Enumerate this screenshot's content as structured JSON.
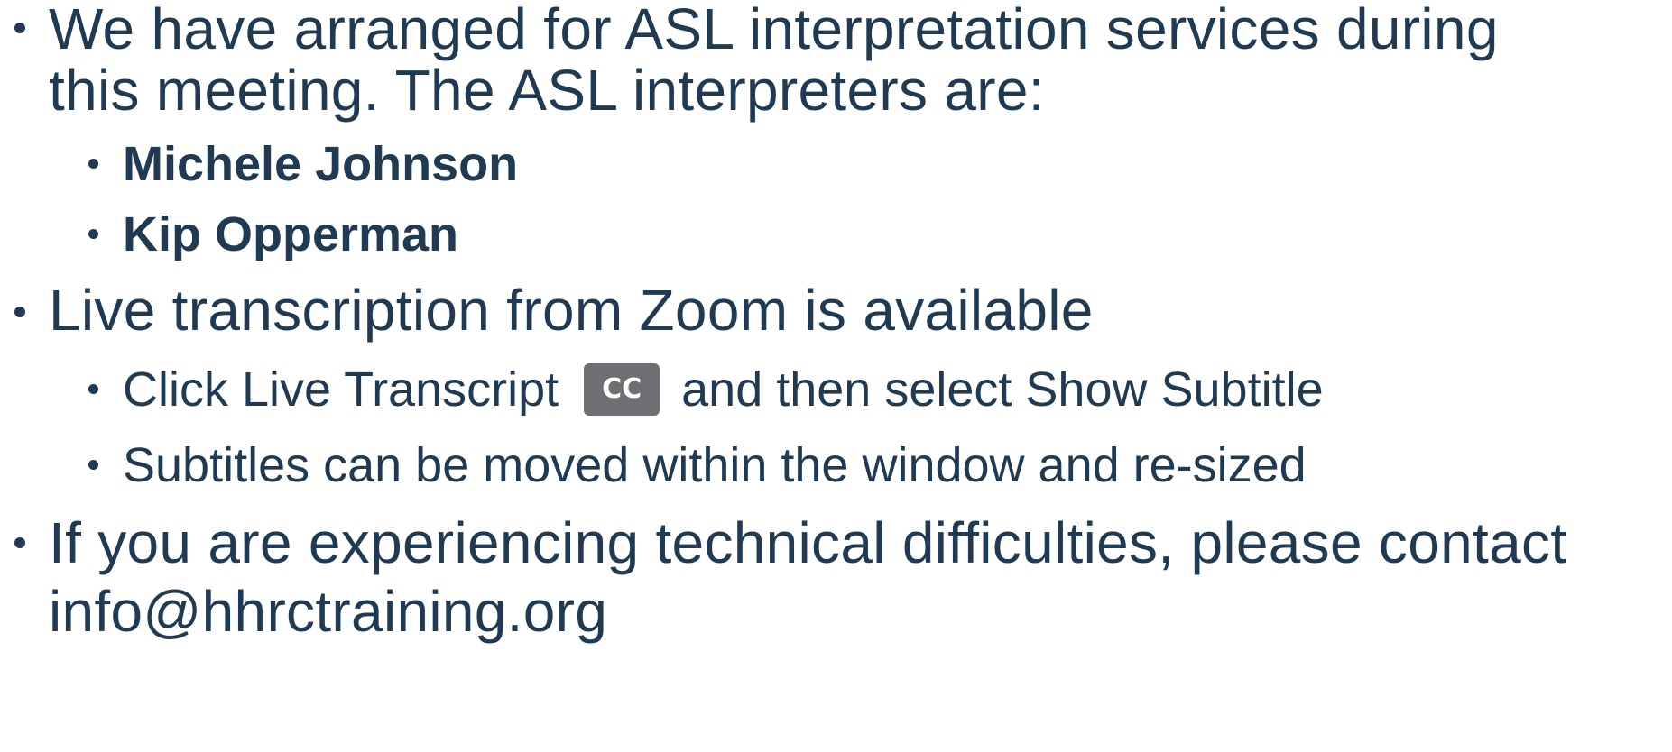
{
  "content": {
    "item1": {
      "line1": "We have arranged for ASL interpretation services during",
      "line2": "this meeting. The ASL interpreters are:"
    },
    "interpreters": [
      "Michele Johnson",
      "Kip Opperman"
    ],
    "item2": "Live transcription from Zoom is available",
    "sub1": {
      "before": "Click Live Transcript",
      "icon_label": "CC",
      "icon": "closed-caption-icon",
      "after": "and then select Show Subtitle"
    },
    "sub2": "Subtitles can be moved within the window and re-sized",
    "item3": {
      "line1": "If you are experiencing technical difficulties, please contact",
      "line2": "info@hhrctraining.org"
    }
  },
  "colors": {
    "text": "#1f3a52",
    "icon_bg": "#6f6f73",
    "icon_text": "#ffffff"
  }
}
